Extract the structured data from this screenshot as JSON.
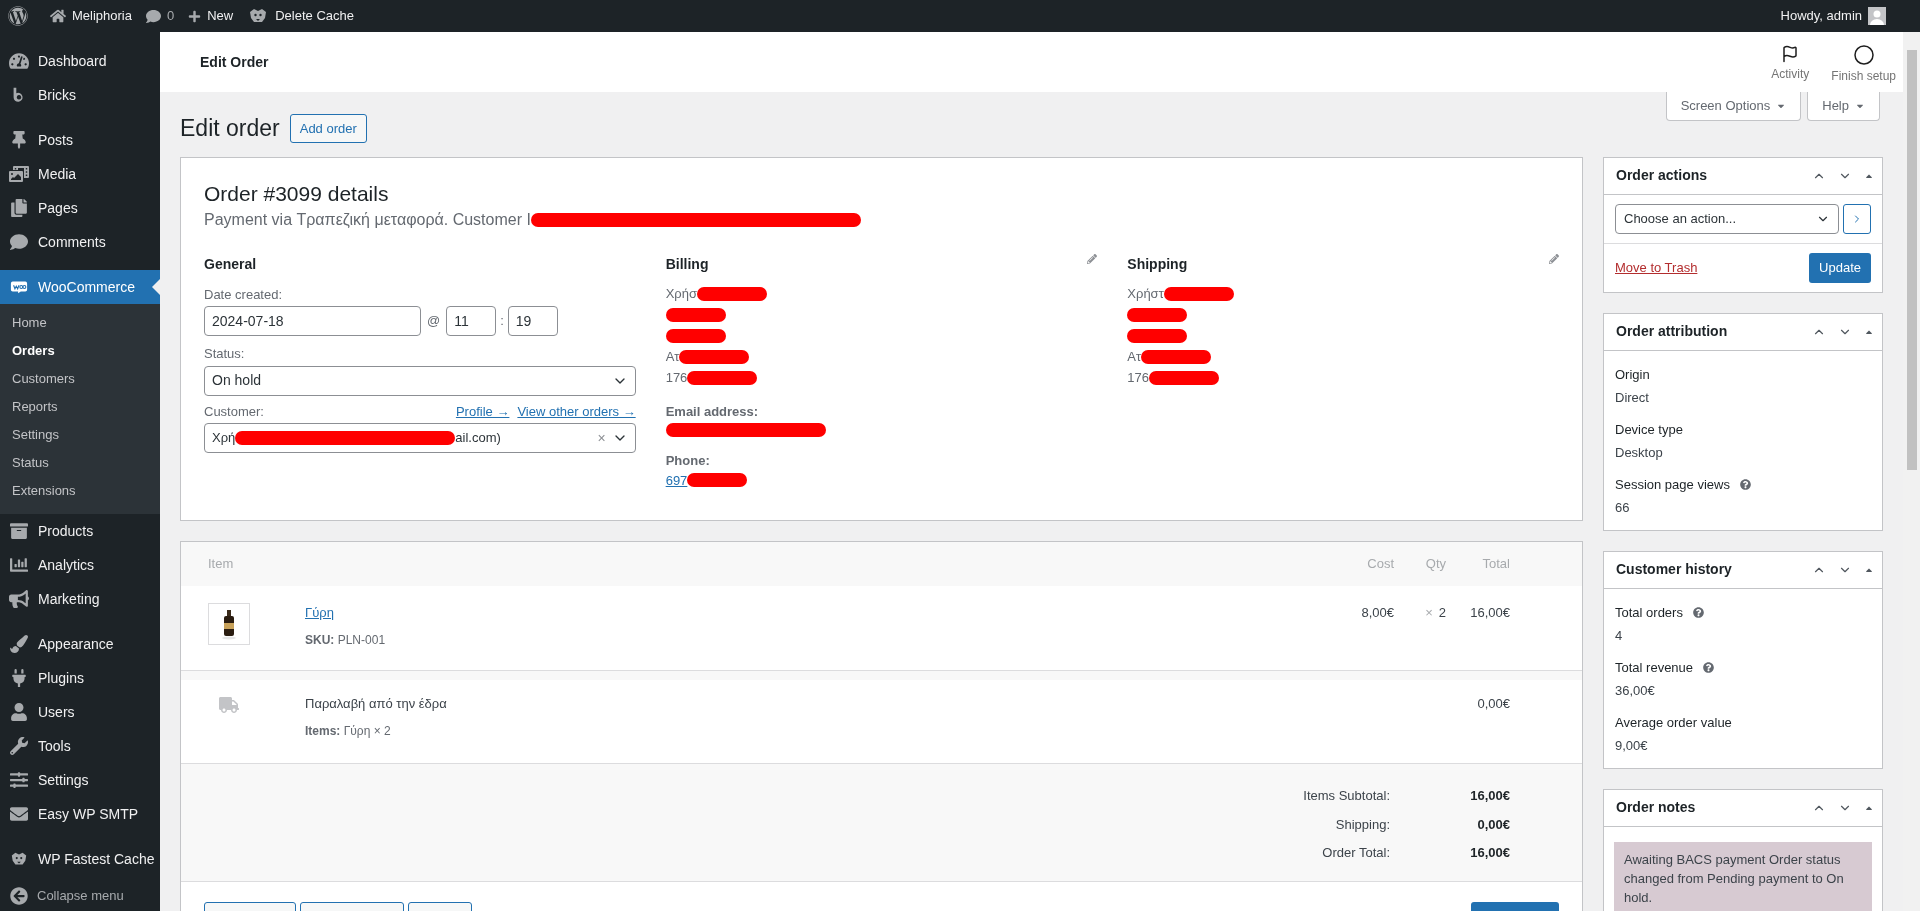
{
  "admin_bar": {
    "site": "Meliphoria",
    "comments": "0",
    "new": "New",
    "cache": "Delete Cache",
    "greeting": "Howdy, admin"
  },
  "sidebar": {
    "groups": [
      [
        {
          "label": "Dashboard",
          "selected": false
        },
        {
          "label": "Bricks",
          "selected": false
        }
      ],
      [
        {
          "label": "Posts",
          "selected": false
        },
        {
          "label": "Media",
          "selected": false
        },
        {
          "label": "Pages",
          "selected": false
        },
        {
          "label": "Comments",
          "selected": false
        }
      ],
      [
        {
          "label": "WooCommerce",
          "selected": true,
          "children": [
            {
              "label": "Home",
              "selected": false
            },
            {
              "label": "Orders",
              "selected": true
            },
            {
              "label": "Customers",
              "selected": false
            },
            {
              "label": "Reports",
              "selected": false
            },
            {
              "label": "Settings",
              "selected": false
            },
            {
              "label": "Status",
              "selected": false
            },
            {
              "label": "Extensions",
              "selected": false
            }
          ]
        },
        {
          "label": "Products",
          "selected": false
        },
        {
          "label": "Analytics",
          "selected": false
        },
        {
          "label": "Marketing",
          "selected": false
        }
      ],
      [
        {
          "label": "Appearance",
          "selected": false
        },
        {
          "label": "Plugins",
          "selected": false
        },
        {
          "label": "Users",
          "selected": false
        },
        {
          "label": "Tools",
          "selected": false
        },
        {
          "label": "Settings",
          "selected": false
        },
        {
          "label": "Easy WP SMTP",
          "selected": false
        }
      ],
      [
        {
          "label": "WP Fastest Cache",
          "selected": false
        }
      ]
    ],
    "collapse": "Collapse menu"
  },
  "header": {
    "title": "Edit Order",
    "actions": [
      "Activity",
      "Finish setup"
    ]
  },
  "screen_tabs": [
    "Screen Options",
    "Help"
  ],
  "page": {
    "title": "Edit order",
    "add_button": "Add order"
  },
  "order": {
    "title": "Order #3099 details",
    "payment": "Payment via Τραπεζική μεταφορά. Customer I",
    "payment_redacted": true,
    "general": {
      "heading": "General",
      "date_label": "Date created:",
      "date": "2024-07-18",
      "at": "@",
      "hour": "11",
      "sep": ":",
      "minute": "19",
      "status_label": "Status:",
      "status": "On hold",
      "customer_label": "Customer:",
      "links": [
        "Profile →",
        "View other orders →"
      ],
      "customer_start": "Χρή",
      "customer_end": "ail.com)",
      "customer_redacted": true,
      "clear": "×"
    },
    "billing": {
      "heading": "Billing",
      "lines": [
        {
          "text": "Χρήσ",
          "redacted": true
        },
        {
          "redacted": true
        },
        {
          "redacted": true
        },
        {
          "text": "Ατ",
          "redacted": true
        },
        {
          "text": "176",
          "redacted": true
        }
      ],
      "email_label": "Email address:",
      "email_redacted": true,
      "phone_label": "Phone:",
      "phone": "697",
      "phone_redacted": true
    },
    "shipping": {
      "heading": "Shipping",
      "lines": [
        {
          "text": "Χρήστ",
          "redacted": true
        },
        {
          "redacted": true
        },
        {
          "redacted": true
        },
        {
          "text": "Ατ",
          "redacted": true
        },
        {
          "text": "176",
          "redacted": true
        }
      ]
    }
  },
  "items": {
    "columns": [
      "Item",
      "Cost",
      "Qty",
      "Total"
    ],
    "rows": [
      {
        "kind": "product",
        "name": "Γύρη",
        "sku_label": "SKU:",
        "sku": "PLN-001",
        "cost": "8,00€",
        "qty_x": "×",
        "qty": "2",
        "total": "16,00€"
      },
      {
        "kind": "shipping",
        "name": "Παραλαβή από την έδρα",
        "items_label": "Items:",
        "items": "Γύρη × 2",
        "total": "0,00€"
      }
    ],
    "totals": [
      {
        "label": "Items Subtotal:",
        "value": "16,00€"
      },
      {
        "label": "Shipping:",
        "value": "0,00€"
      },
      {
        "label": "Order Total:",
        "value": "16,00€"
      }
    ]
  },
  "side_boxes": [
    {
      "kind": "actions",
      "title": "Order actions",
      "select": "Choose an action...",
      "trash": "Move to Trash",
      "update": "Update"
    },
    {
      "kind": "fields",
      "title": "Order attribution",
      "fields": [
        {
          "label": "Origin",
          "value": "Direct",
          "help": false
        },
        {
          "label": "Device type",
          "value": "Desktop",
          "help": false
        },
        {
          "label": "Session page views",
          "value": "66",
          "help": true
        }
      ]
    },
    {
      "kind": "fields",
      "title": "Customer history",
      "fields": [
        {
          "label": "Total orders",
          "value": "4",
          "help": true
        },
        {
          "label": "Total revenue",
          "value": "36,00€",
          "help": true
        },
        {
          "label": "Average order value",
          "value": "9,00€",
          "help": false
        }
      ]
    },
    {
      "kind": "notes",
      "title": "Order notes",
      "notes": [
        "Awaiting BACS payment Order status changed from Pending payment to On hold."
      ]
    }
  ]
}
